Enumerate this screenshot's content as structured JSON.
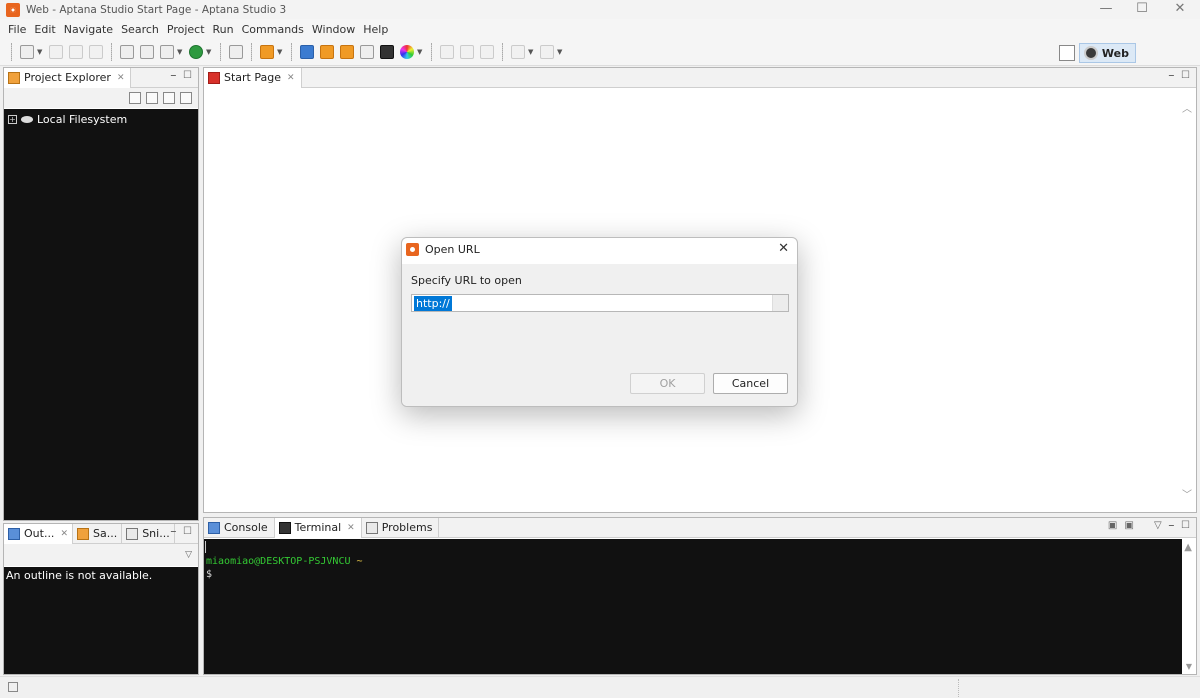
{
  "window": {
    "title": "Web - Aptana Studio Start Page - Aptana Studio 3",
    "minimize_glyph": "—",
    "maximize_glyph": "☐",
    "close_glyph": "✕"
  },
  "menu": [
    "File",
    "Edit",
    "Navigate",
    "Search",
    "Project",
    "Run",
    "Commands",
    "Window",
    "Help"
  ],
  "perspective": {
    "label": "Web"
  },
  "project_explorer": {
    "tab_label": "Project Explorer",
    "tree": [
      {
        "label": "Local Filesystem",
        "expanded": false
      }
    ]
  },
  "editor": {
    "tab_label": "Start Page"
  },
  "outline_views": {
    "tabs": [
      "Out...",
      "Sa...",
      "Sni..."
    ],
    "message": "An outline is not available."
  },
  "bottom_views": {
    "tabs": [
      "Console",
      "Terminal",
      "Problems"
    ],
    "active_tab": "Terminal"
  },
  "terminal": {
    "prompt_user": "miaomiao@DESKTOP-PSJVNCU",
    "prompt_path": "~",
    "prompt_symbol": "$"
  },
  "dialog": {
    "title": "Open URL",
    "label": "Specify URL to open",
    "url_value": "http://",
    "ok_label": "OK",
    "cancel_label": "Cancel",
    "ok_enabled": false
  },
  "icons": {
    "app": "aptana-icon",
    "close_tab": "close-tab-icon"
  }
}
